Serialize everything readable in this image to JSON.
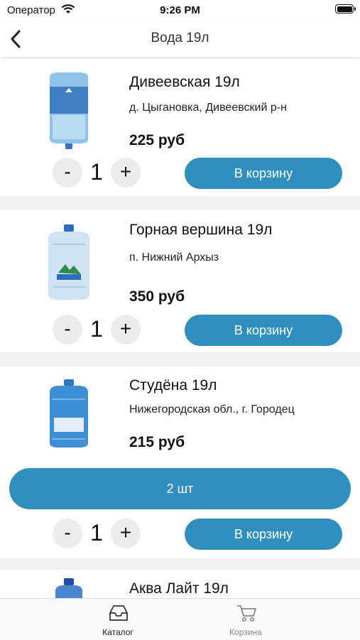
{
  "status_bar": {
    "carrier": "Оператор",
    "time": "9:26 PM"
  },
  "nav": {
    "title": "Вода 19л"
  },
  "products": [
    {
      "name": "Дивеевская 19л",
      "origin": "д. Цыгановка, Дивеевский р-н",
      "price": "225 руб",
      "qty_minus": "-",
      "quantity": "1",
      "qty_plus": "+",
      "cart_label": "В корзину"
    },
    {
      "name": "Горная вершина 19л",
      "origin": "п. Нижний Архыз",
      "price": "350 руб",
      "qty_minus": "-",
      "quantity": "1",
      "qty_plus": "+",
      "cart_label": "В корзину"
    },
    {
      "name": "Студёна 19л",
      "origin": "Нижегородская обл., г. Городец",
      "price": "215 руб",
      "in_cart_label": "2 шт",
      "qty_minus": "-",
      "quantity": "1",
      "qty_plus": "+",
      "cart_label": "В корзину"
    },
    {
      "name": "Аква Лайт 19л"
    }
  ],
  "tab_bar": {
    "catalog": {
      "label": "Каталог",
      "icon": "inbox-icon"
    },
    "cart": {
      "label": "Корзина",
      "icon": "shopping-cart-icon"
    }
  },
  "colors": {
    "accent": "#2f8fbf",
    "background": "#f0f0f0"
  }
}
